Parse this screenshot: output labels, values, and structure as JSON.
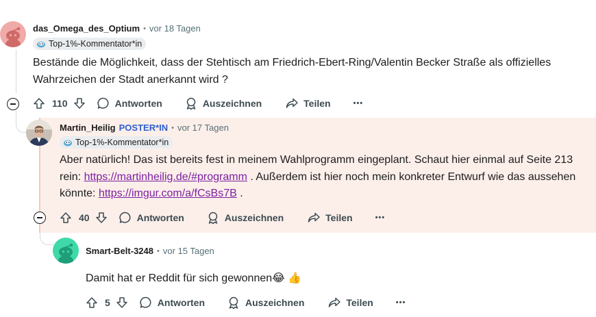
{
  "comments": [
    {
      "author": "das_Omega_des_Optium",
      "time": "vor 18 Tagen",
      "flair": "Top-1%-Kommentator*in",
      "body": "Bestände die Möglichkeit, dass der Stehtisch am Friedrich-Ebert-Ring/Valentin Becker Straße als offizielles Wahrzeichen der Stadt anerkannt wird ?",
      "score": "110",
      "reply_label": "Antworten",
      "award_label": "Auszeichnen",
      "share_label": "Teilen",
      "more_label": "•••"
    },
    {
      "author": "Martin_Heilig",
      "badge": "POSTER*IN",
      "time": "vor 17 Tagen",
      "flair": "Top-1%-Kommentator*in",
      "body_part1": "Aber natürlich! Das ist bereits fest in meinem Wahlprogramm eingeplant. Schaut hier einmal auf Seite 213 rein: ",
      "link1": "https://martinheilig.de/#programm",
      "body_part2": " . Außerdem ist hier noch mein konkreter Entwurf wie das aussehen könnte: ",
      "link2": "https://imgur.com/a/fCsBs7B",
      "body_part3": " .",
      "score": "40",
      "reply_label": "Antworten",
      "award_label": "Auszeichnen",
      "share_label": "Teilen",
      "more_label": "•••"
    },
    {
      "author": "Smart-Belt-3248",
      "time": "vor 15 Tagen",
      "body": "Damit hat er Reddit für sich gewonnen😂 👍",
      "score": "5",
      "reply_label": "Antworten",
      "award_label": "Auszeichnen",
      "share_label": "Teilen",
      "more_label": "•••"
    }
  ],
  "icons": {
    "upvote": "upvote-icon",
    "downvote": "downvote-icon",
    "reply": "comment-bubble-icon",
    "award": "award-icon",
    "share": "share-icon",
    "more": "more-dots-icon",
    "collapse": "collapse-minus-icon",
    "flair": "snoo-flair-icon"
  },
  "colors": {
    "poster_badge": "#2f5fce",
    "link": "#7b1fa2",
    "highlight_bg": "#fcefea",
    "avatar1": "#f0aaa8",
    "avatar3": "#3fd9a9"
  }
}
